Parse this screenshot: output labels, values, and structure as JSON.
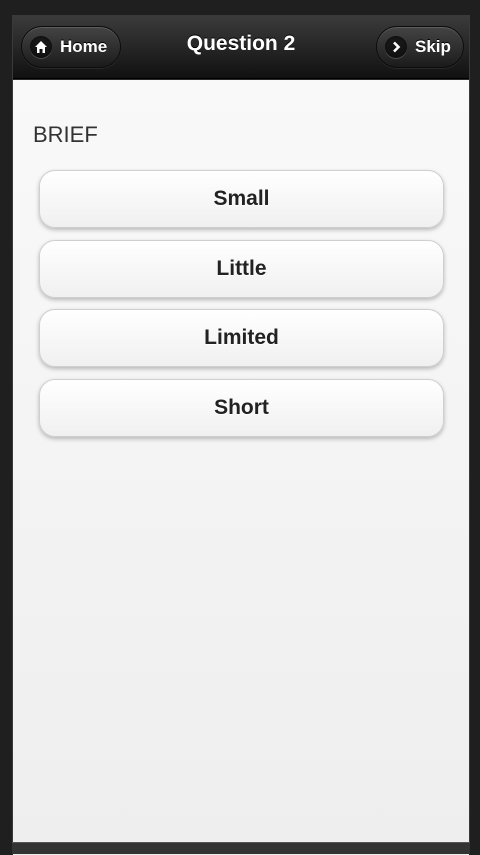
{
  "header": {
    "title": "Question 2",
    "home_label": "Home",
    "skip_label": "Skip"
  },
  "question": {
    "word": "BRIEF"
  },
  "options": [
    {
      "label": "Small"
    },
    {
      "label": "Little"
    },
    {
      "label": "Limited"
    },
    {
      "label": "Short"
    }
  ],
  "icons": {
    "home": "home-icon",
    "skip": "chevron-right-icon"
  }
}
